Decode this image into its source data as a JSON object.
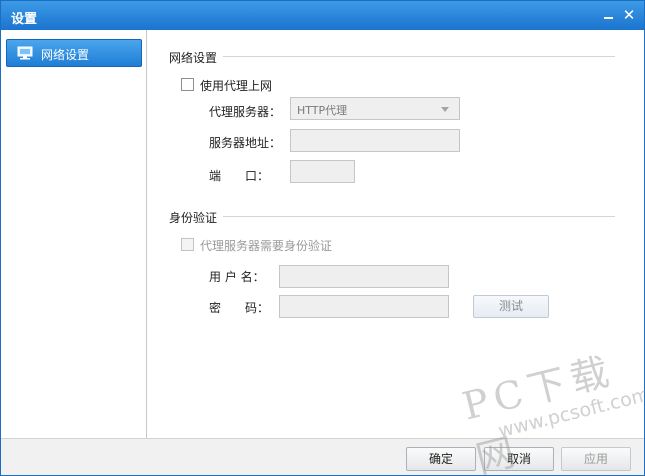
{
  "window": {
    "title": "设置"
  },
  "titlebar": {
    "minimize_icon": "minimize-icon",
    "close_icon": "close-icon"
  },
  "sidebar": {
    "items": [
      {
        "label": "网络设置",
        "icon": "network-computer-icon",
        "selected": true
      }
    ]
  },
  "proxy_section": {
    "title": "网络设置",
    "use_proxy_label": "使用代理上网",
    "use_proxy_checked": false,
    "server_type_label": "代理服务器：",
    "server_type_value": "HTTP代理",
    "address_label": "服务器地址：",
    "address_value": "",
    "port_label": "端　　口：",
    "port_value": ""
  },
  "auth_section": {
    "title": "身份验证",
    "require_auth_label": "代理服务器需要身份验证",
    "require_auth_checked": false,
    "username_label": "用 户 名：",
    "username_value": "",
    "password_label": "密　　码：",
    "password_value": "",
    "test_button_label": "测试"
  },
  "footer": {
    "ok_label": "确定",
    "cancel_label": "取消",
    "apply_label": "应用"
  },
  "watermark": {
    "text": "PC下载网",
    "sub": "www.pcsoft.com.cn"
  },
  "colors": {
    "titlebar": "#1b74cf",
    "selected_item": "#2b87dc"
  }
}
